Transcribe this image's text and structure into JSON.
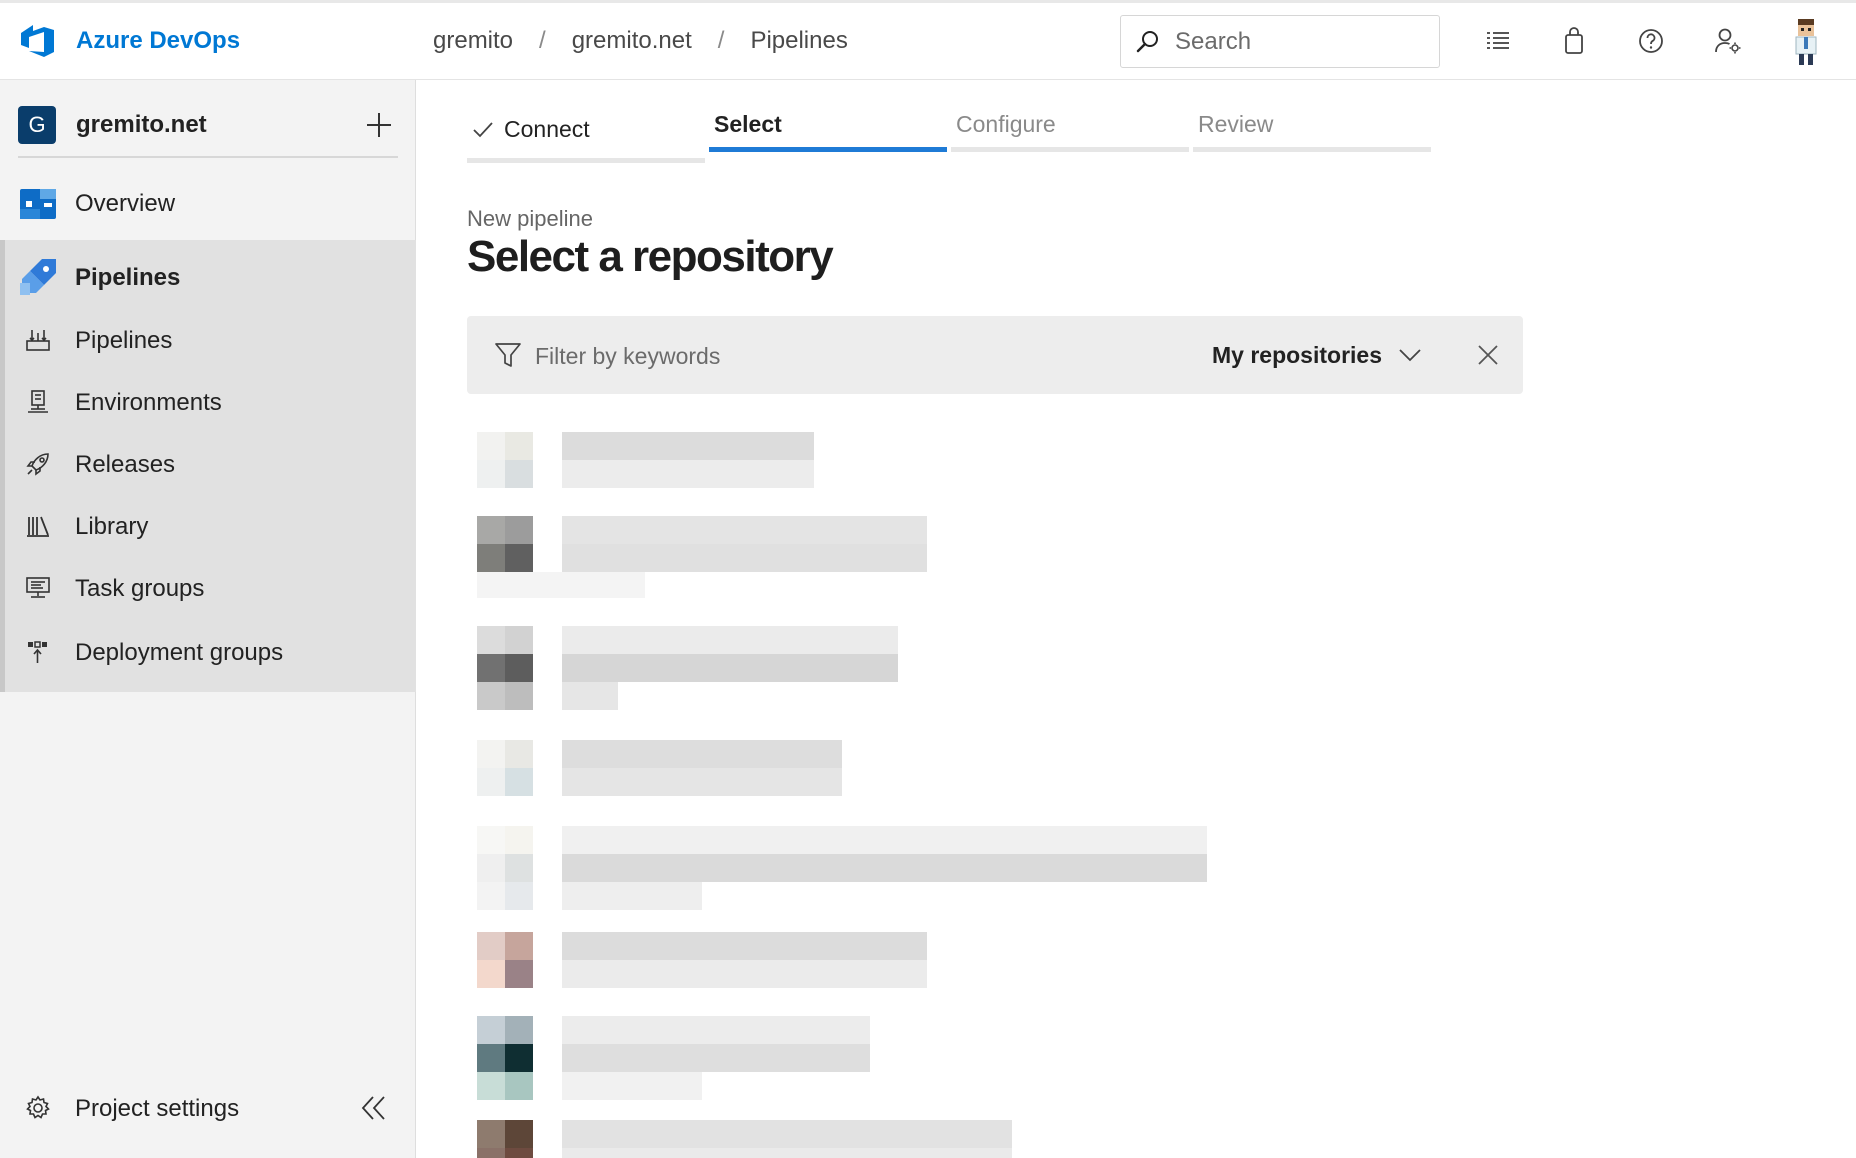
{
  "header": {
    "brand": "Azure DevOps",
    "breadcrumb": [
      "gremito",
      "gremito.net",
      "Pipelines"
    ],
    "breadcrumb_separator": "/",
    "search_placeholder": "Search",
    "icons": [
      "work-items-icon",
      "marketplace-bag-icon",
      "help-icon",
      "user-settings-icon",
      "avatar"
    ]
  },
  "sidebar": {
    "project_initial": "G",
    "project_name": "gremito.net",
    "overview_label": "Overview",
    "pipelines_header": "Pipelines",
    "items": [
      {
        "label": "Pipelines",
        "icon": "pipelines-icon"
      },
      {
        "label": "Environments",
        "icon": "environments-icon"
      },
      {
        "label": "Releases",
        "icon": "releases-rocket-icon"
      },
      {
        "label": "Library",
        "icon": "library-icon"
      },
      {
        "label": "Task groups",
        "icon": "task-groups-icon"
      },
      {
        "label": "Deployment groups",
        "icon": "deployment-groups-icon"
      }
    ],
    "settings_label": "Project settings"
  },
  "wizard": {
    "steps": [
      {
        "label": "Connect",
        "state": "done"
      },
      {
        "label": "Select",
        "state": "active"
      },
      {
        "label": "Configure",
        "state": "pending"
      },
      {
        "label": "Review",
        "state": "pending"
      }
    ],
    "subtitle": "New pipeline",
    "title": "Select a repository"
  },
  "filter": {
    "placeholder": "Filter by keywords",
    "scope_label": "My repositories"
  },
  "colors": {
    "accent": "#0078d4",
    "active_step": "#1f7bd6",
    "project_badge": "#0a3d6b"
  }
}
